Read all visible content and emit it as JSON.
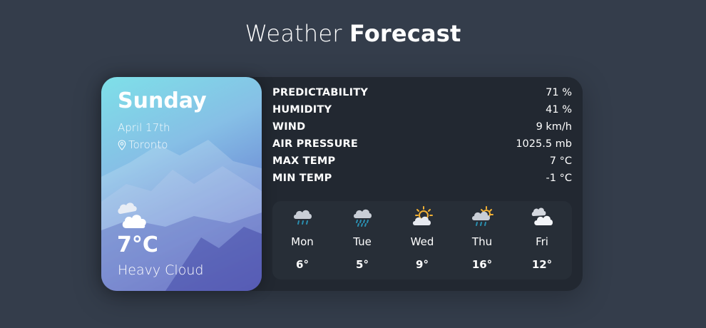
{
  "header": {
    "title_light": "Weather",
    "title_bold": "Forecast"
  },
  "today": {
    "day": "Sunday",
    "date": "April 17th",
    "location": "Toronto",
    "temperature": "7°C",
    "description": "Heavy Cloud",
    "icon": "cloud-icon"
  },
  "stats": [
    {
      "label": "PREDICTABILITY",
      "value": "71 %"
    },
    {
      "label": "HUMIDITY",
      "value": "41 %"
    },
    {
      "label": "WIND",
      "value": "9 km/h"
    },
    {
      "label": "AIR PRESSURE",
      "value": "1025.5 mb"
    },
    {
      "label": "MAX TEMP",
      "value": "7 °C"
    },
    {
      "label": "MIN TEMP",
      "value": "-1 °C"
    }
  ],
  "week": [
    {
      "day": "Mon",
      "temp": "6°",
      "icon": "light-rain-icon"
    },
    {
      "day": "Tue",
      "temp": "5°",
      "icon": "heavy-rain-icon"
    },
    {
      "day": "Wed",
      "temp": "9°",
      "icon": "partly-sunny-icon"
    },
    {
      "day": "Thu",
      "temp": "16°",
      "icon": "sun-rain-icon"
    },
    {
      "day": "Fri",
      "temp": "12°",
      "icon": "cloudy-icon"
    }
  ],
  "colors": {
    "background": "#343d4b",
    "card": "#222831",
    "rain": "#2a8fb0",
    "sun": "#f2b134"
  }
}
